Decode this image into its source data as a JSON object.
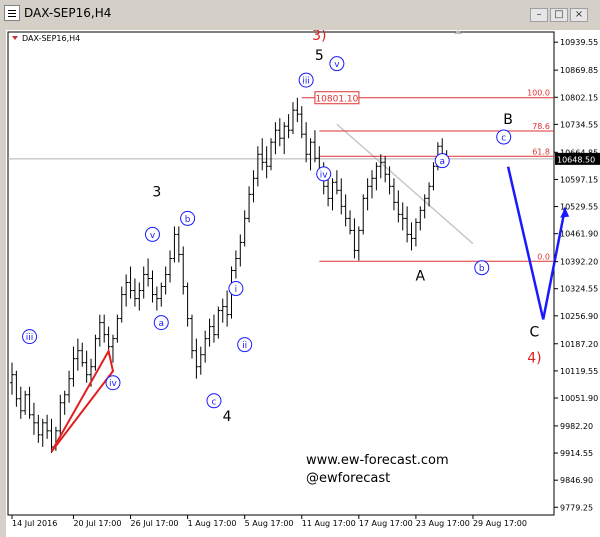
{
  "window": {
    "title": "DAX-SEP16,H4",
    "buttons": [
      "–",
      "□",
      "×"
    ]
  },
  "watermark": {
    "url": "www.ew-forecast.com",
    "handle": "@ewforecast"
  },
  "colors": {
    "candle": "#000000",
    "fib": "#dd3333",
    "blue": "#1a1aff",
    "red_text": "#dd2222"
  },
  "chart_data": {
    "type": "ohlc",
    "symbol": "DAX-SEP16,H4",
    "ylim": [
      9750,
      11000
    ],
    "y_ticks": [
      10939.55,
      10869.85,
      10802.15,
      10734.55,
      10664.85,
      10597.15,
      10529.55,
      10461.9,
      10392.2,
      10324.55,
      10256.9,
      10187.2,
      10119.55,
      10051.9,
      9982.2,
      9914.55,
      9846.9,
      9779.25
    ],
    "y_tick_labels": [
      "10939.55",
      "10869.85",
      "10802.15",
      "10734.55",
      "10664.85",
      "10597.15",
      "10529.55",
      "10461.90",
      "10392.20",
      "10324.55",
      "10256.90",
      "10187.20",
      "10119.55",
      "10051.90",
      "9982.20",
      "9914.55",
      "9846.90",
      "9779.25"
    ],
    "x_labels": [
      "14 Jul 2016",
      "20 Jul 17:00",
      "26 Jul 17:00",
      "1 Aug 17:00",
      "5 Aug 17:00",
      "11 Aug 17:00",
      "17 Aug 17:00",
      "23 Aug 17:00",
      "29 Aug 17:00"
    ],
    "x_label_bars": [
      0,
      14,
      27,
      40,
      53,
      66,
      79,
      92,
      105
    ],
    "bars_count": 120,
    "current_price": "10648.50",
    "current_value": 10648.5,
    "ohlc": [
      [
        10090,
        10140,
        10060,
        10110
      ],
      [
        10110,
        10120,
        10030,
        10050
      ],
      [
        10050,
        10080,
        10000,
        10020
      ],
      [
        10020,
        10070,
        10010,
        10060
      ],
      [
        10060,
        10080,
        10000,
        10010
      ],
      [
        10010,
        10040,
        9960,
        9990
      ],
      [
        9990,
        10010,
        9940,
        9960
      ],
      [
        9960,
        10000,
        9930,
        9990
      ],
      [
        9990,
        10010,
        9950,
        9970
      ],
      [
        9970,
        10000,
        9915,
        9930
      ],
      [
        9930,
        9980,
        9920,
        9970
      ],
      [
        9970,
        10060,
        9960,
        10040
      ],
      [
        10040,
        10070,
        10010,
        10060
      ],
      [
        10060,
        10120,
        10040,
        10100
      ],
      [
        10100,
        10180,
        10080,
        10150
      ],
      [
        10150,
        10200,
        10120,
        10170
      ],
      [
        10170,
        10190,
        10130,
        10140
      ],
      [
        10140,
        10170,
        10090,
        10110
      ],
      [
        10110,
        10150,
        10080,
        10130
      ],
      [
        10130,
        10210,
        10120,
        10200
      ],
      [
        10200,
        10260,
        10180,
        10240
      ],
      [
        10240,
        10260,
        10190,
        10210
      ],
      [
        10210,
        10230,
        10160,
        10180
      ],
      [
        10180,
        10210,
        10140,
        10200
      ],
      [
        10200,
        10260,
        10190,
        10250
      ],
      [
        10250,
        10330,
        10240,
        10310
      ],
      [
        10310,
        10360,
        10280,
        10340
      ],
      [
        10340,
        10380,
        10300,
        10320
      ],
      [
        10320,
        10350,
        10280,
        10300
      ],
      [
        10300,
        10340,
        10270,
        10320
      ],
      [
        10320,
        10380,
        10300,
        10360
      ],
      [
        10360,
        10400,
        10330,
        10350
      ],
      [
        10350,
        10370,
        10290,
        10310
      ],
      [
        10310,
        10330,
        10270,
        10300
      ],
      [
        10300,
        10340,
        10280,
        10330
      ],
      [
        10330,
        10380,
        10310,
        10360
      ],
      [
        10360,
        10420,
        10340,
        10400
      ],
      [
        10400,
        10480,
        10390,
        10460
      ],
      [
        10460,
        10480,
        10390,
        10410
      ],
      [
        10410,
        10430,
        10310,
        10330
      ],
      [
        10330,
        10340,
        10230,
        10250
      ],
      [
        10250,
        10260,
        10150,
        10170
      ],
      [
        10170,
        10200,
        10100,
        10130
      ],
      [
        10130,
        10180,
        10110,
        10160
      ],
      [
        10160,
        10220,
        10140,
        10200
      ],
      [
        10200,
        10250,
        10180,
        10230
      ],
      [
        10230,
        10260,
        10190,
        10210
      ],
      [
        10210,
        10280,
        10200,
        10270
      ],
      [
        10270,
        10300,
        10240,
        10280
      ],
      [
        10280,
        10320,
        10230,
        10260
      ],
      [
        10260,
        10380,
        10250,
        10370
      ],
      [
        10370,
        10420,
        10350,
        10400
      ],
      [
        10400,
        10460,
        10380,
        10440
      ],
      [
        10440,
        10520,
        10430,
        10500
      ],
      [
        10500,
        10580,
        10490,
        10560
      ],
      [
        10560,
        10620,
        10540,
        10600
      ],
      [
        10600,
        10680,
        10580,
        10660
      ],
      [
        10660,
        10700,
        10620,
        10640
      ],
      [
        10640,
        10680,
        10600,
        10630
      ],
      [
        10630,
        10700,
        10620,
        10690
      ],
      [
        10690,
        10740,
        10660,
        10720
      ],
      [
        10720,
        10750,
        10680,
        10700
      ],
      [
        10700,
        10740,
        10660,
        10730
      ],
      [
        10730,
        10760,
        10700,
        10720
      ],
      [
        10720,
        10790,
        10710,
        10770
      ],
      [
        10770,
        10801,
        10740,
        10760
      ],
      [
        10760,
        10780,
        10700,
        10710
      ],
      [
        10710,
        10740,
        10640,
        10660
      ],
      [
        10660,
        10700,
        10620,
        10690
      ],
      [
        10690,
        10720,
        10640,
        10650
      ],
      [
        10650,
        10680,
        10600,
        10620
      ],
      [
        10620,
        10640,
        10560,
        10580
      ],
      [
        10580,
        10610,
        10530,
        10550
      ],
      [
        10550,
        10600,
        10520,
        10590
      ],
      [
        10590,
        10620,
        10560,
        10570
      ],
      [
        10570,
        10600,
        10510,
        10530
      ],
      [
        10530,
        10560,
        10480,
        10500
      ],
      [
        10500,
        10520,
        10460,
        10470
      ],
      [
        10470,
        10500,
        10400,
        10420
      ],
      [
        10420,
        10480,
        10395,
        10470
      ],
      [
        10470,
        10560,
        10460,
        10550
      ],
      [
        10550,
        10600,
        10520,
        10580
      ],
      [
        10580,
        10620,
        10550,
        10600
      ],
      [
        10600,
        10640,
        10570,
        10630
      ],
      [
        10630,
        10660,
        10600,
        10640
      ],
      [
        10640,
        10655,
        10590,
        10610
      ],
      [
        10610,
        10630,
        10560,
        10580
      ],
      [
        10580,
        10600,
        10520,
        10540
      ],
      [
        10540,
        10570,
        10490,
        10510
      ],
      [
        10510,
        10540,
        10470,
        10500
      ],
      [
        10500,
        10530,
        10440,
        10460
      ],
      [
        10460,
        10490,
        10420,
        10450
      ],
      [
        10450,
        10500,
        10430,
        10490
      ],
      [
        10490,
        10530,
        10470,
        10520
      ],
      [
        10520,
        10560,
        10500,
        10550
      ],
      [
        10550,
        10590,
        10530,
        10580
      ],
      [
        10580,
        10640,
        10570,
        10630
      ],
      [
        10630,
        10690,
        10620,
        10680
      ],
      [
        10680,
        10700,
        10640,
        10660
      ],
      [
        10660,
        10670,
        10630,
        10648
      ]
    ],
    "fib_levels": [
      {
        "label": "100.0",
        "value": 10801
      },
      {
        "label": "78.6",
        "value": 10718
      },
      {
        "label": "61.8",
        "value": 10655
      },
      {
        "label": "0.0",
        "value": 10393
      }
    ],
    "price_box": "10801.10",
    "wave_labels": [
      {
        "text": "3)",
        "bar": 70,
        "value": 10945,
        "color": "red"
      },
      {
        "text": "5",
        "bar": 70,
        "value": 10895,
        "color": "black"
      },
      {
        "text": "3",
        "bar": 33,
        "value": 10555,
        "color": "black"
      },
      {
        "text": "4",
        "bar": 49,
        "value": 9995,
        "color": "black"
      },
      {
        "text": "B",
        "bar": 113,
        "value": 10735,
        "color": "black"
      },
      {
        "text": "A",
        "bar": 93,
        "value": 10345,
        "color": "black"
      },
      {
        "text": "C",
        "bar": 119,
        "value": 10205,
        "color": "black"
      },
      {
        "text": "4)",
        "bar": 119,
        "value": 10140,
        "color": "red"
      }
    ],
    "circle_labels": [
      {
        "text": "iii",
        "bar": 4,
        "value": 10205
      },
      {
        "text": "iv",
        "bar": 23,
        "value": 10090
      },
      {
        "text": "v",
        "bar": 32,
        "value": 10460
      },
      {
        "text": "b",
        "bar": 40,
        "value": 10500
      },
      {
        "text": "a",
        "bar": 34,
        "value": 10240
      },
      {
        "text": "i",
        "bar": 51,
        "value": 10325
      },
      {
        "text": "ii",
        "bar": 53,
        "value": 10185
      },
      {
        "text": "c",
        "bar": 46,
        "value": 10045
      },
      {
        "text": "iii",
        "bar": 67,
        "value": 10845
      },
      {
        "text": "v",
        "bar": 74,
        "value": 10886
      },
      {
        "text": "iv",
        "bar": 71,
        "value": 10611
      },
      {
        "text": "a",
        "bar": 98,
        "value": 10644
      },
      {
        "text": "b",
        "bar": 107,
        "value": 10377
      },
      {
        "text": "c",
        "bar": 112,
        "value": 10703
      }
    ],
    "red_triangle": [
      [
        9,
        9918
      ],
      [
        22,
        10169
      ],
      [
        23,
        10119
      ],
      [
        9,
        9918
      ]
    ],
    "blue_projection": [
      [
        113,
        10629
      ],
      [
        121,
        10248
      ],
      [
        126,
        10527
      ]
    ],
    "grey_diagonal": [
      [
        74,
        10735
      ],
      [
        105,
        10437
      ]
    ]
  }
}
